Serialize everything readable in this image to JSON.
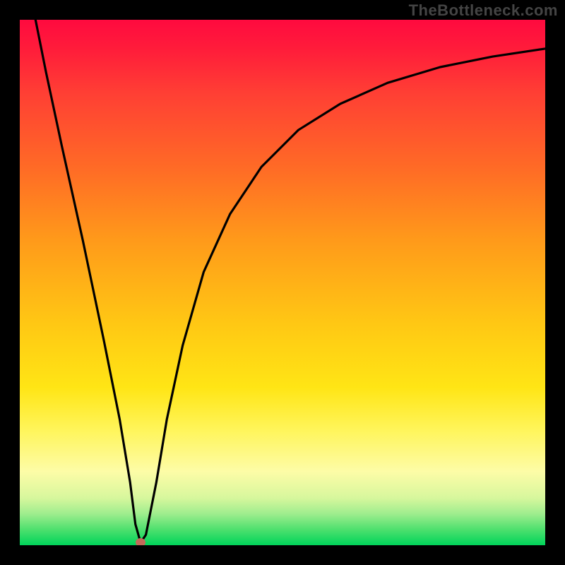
{
  "watermark": "TheBottleneck.com",
  "chart_data": {
    "type": "line",
    "title": "",
    "xlabel": "",
    "ylabel": "",
    "x_range": [
      0,
      100
    ],
    "y_range": [
      0,
      100
    ],
    "curve": {
      "x": [
        3,
        5,
        8,
        12,
        16,
        19,
        21,
        22,
        23,
        24,
        26,
        28,
        31,
        35,
        40,
        46,
        53,
        61,
        70,
        80,
        90,
        100
      ],
      "y": [
        100,
        90,
        76,
        58,
        39,
        24,
        12,
        4,
        0.5,
        2,
        12,
        24,
        38,
        52,
        63,
        72,
        79,
        84,
        88,
        91,
        93,
        94.5
      ]
    },
    "min_point": {
      "x": 23,
      "y": 0.5,
      "color": "#c36a5a"
    },
    "background_gradient": {
      "top": "#ff0a3f",
      "middle": "#ffe515",
      "bottom": "#00d45a"
    }
  }
}
